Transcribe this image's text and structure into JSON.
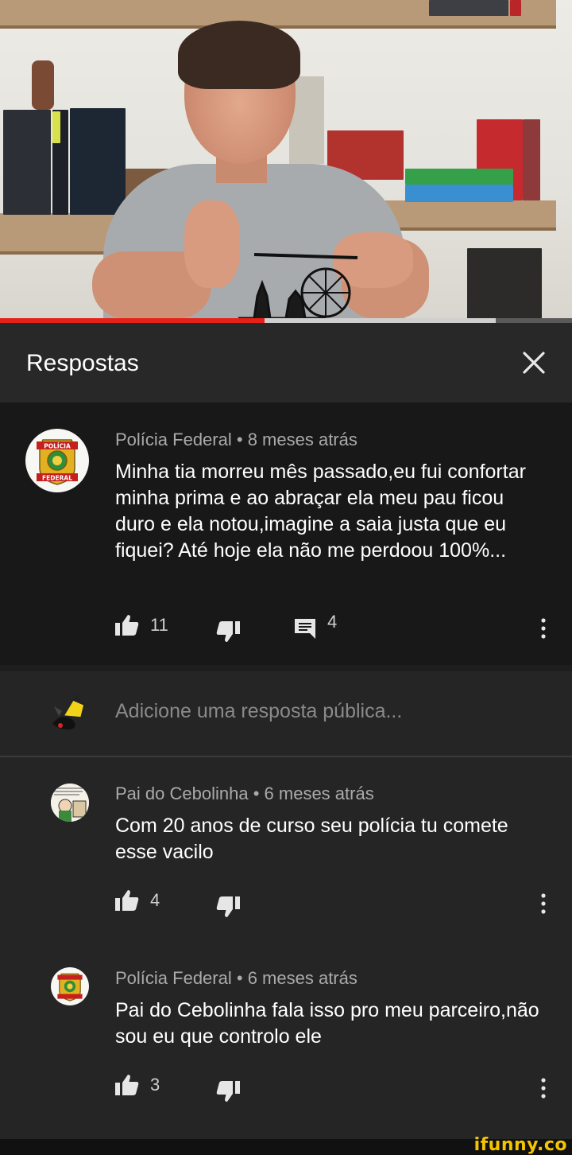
{
  "video": {
    "progress_played": 0.463,
    "progress_buffered": 0.867
  },
  "panel": {
    "title": "Respostas"
  },
  "main_comment": {
    "author": "Polícia Federal",
    "time": "8 meses atrás",
    "text": "Minha tia morreu mês passado,eu fui confortar minha prima e ao abraçar ela meu pau ficou duro e ela notou,imagine a saia justa que eu fiquei?  Até hoje ela não me perdoou 100%...",
    "likes": "11",
    "replies": "4",
    "avatar_text": [
      "POLÍCIA",
      "FEDERAL"
    ]
  },
  "reply_input": {
    "placeholder": "Adicione uma resposta pública..."
  },
  "replies": [
    {
      "author": "Pai do Cebolinha",
      "time": "6 meses atrás",
      "text": "Com 20 anos de curso seu polícia tu comete esse vacilo",
      "likes": "4"
    },
    {
      "author": "Polícia Federal",
      "time": "6 meses atrás",
      "text": "Pai do Cebolinha fala isso pro meu parceiro,não sou eu que controlo ele",
      "likes": "3"
    }
  ],
  "separator": "•",
  "watermark": "ifunny.co",
  "colors": {
    "progress_played": "#e62117",
    "background": "#212121",
    "comment_bg": "#181818",
    "meta_text": "#aaaaaa"
  }
}
